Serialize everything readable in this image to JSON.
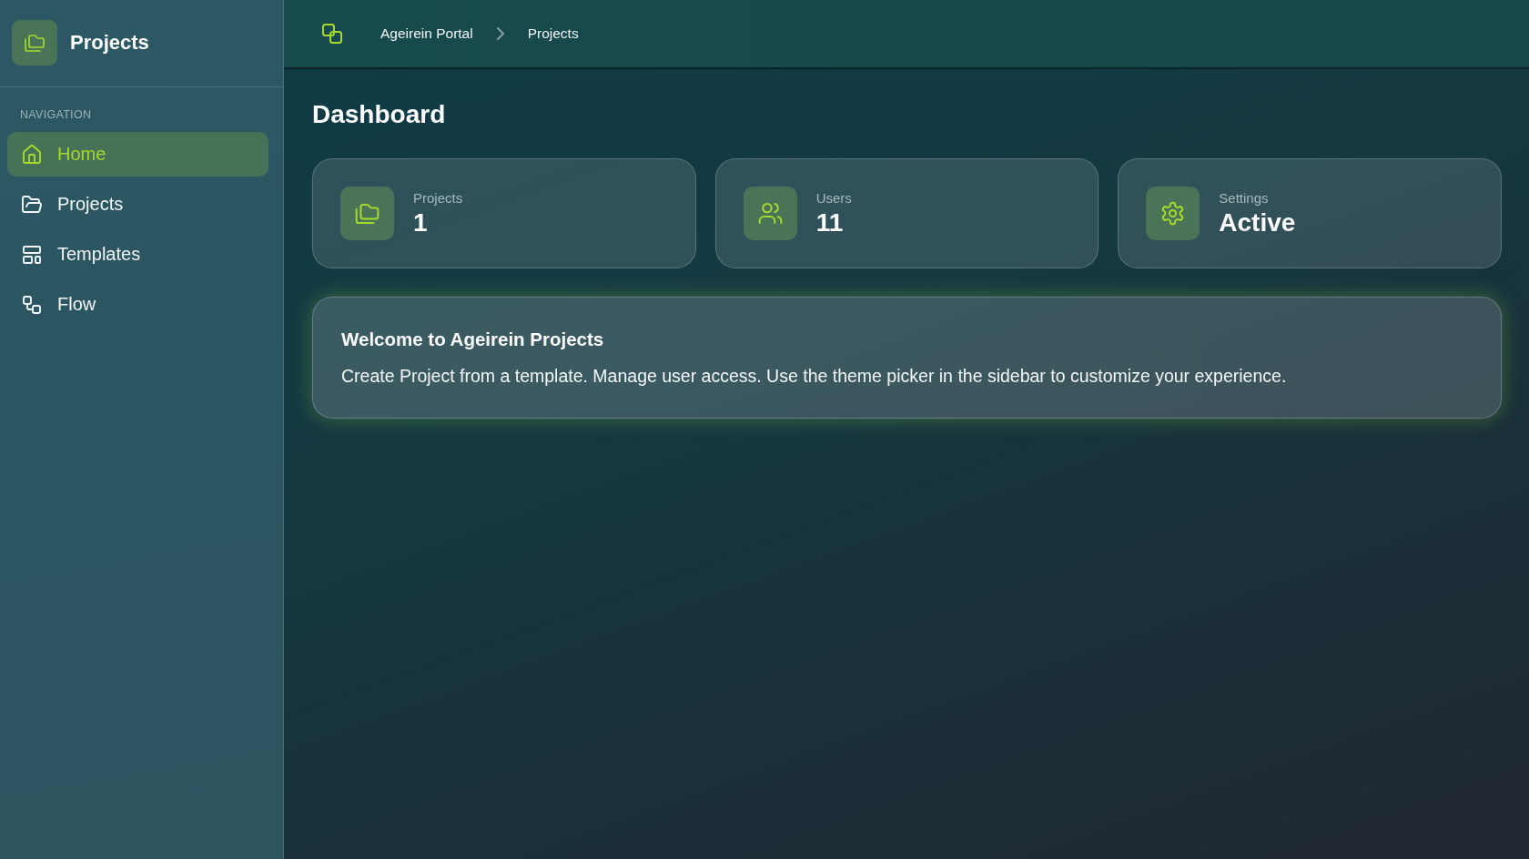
{
  "sidebar": {
    "title": "Projects",
    "section_label": "NAVIGATION",
    "items": [
      {
        "label": "Home",
        "selected": true
      },
      {
        "label": "Projects",
        "selected": false
      },
      {
        "label": "Templates",
        "selected": false
      },
      {
        "label": "Flow",
        "selected": false
      }
    ]
  },
  "breadcrumb": [
    "Ageirein Portal",
    "Projects"
  ],
  "page_title": "Dashboard",
  "stats": [
    {
      "label": "Projects",
      "value": "1"
    },
    {
      "label": "Users",
      "value": "11"
    },
    {
      "label": "Settings",
      "value": "Active"
    }
  ],
  "welcome": {
    "title": "Welcome to Ageirein Projects",
    "text": "Create Project from a template. Manage user access. Use the theme picker in the sidebar to customize your experience."
  }
}
